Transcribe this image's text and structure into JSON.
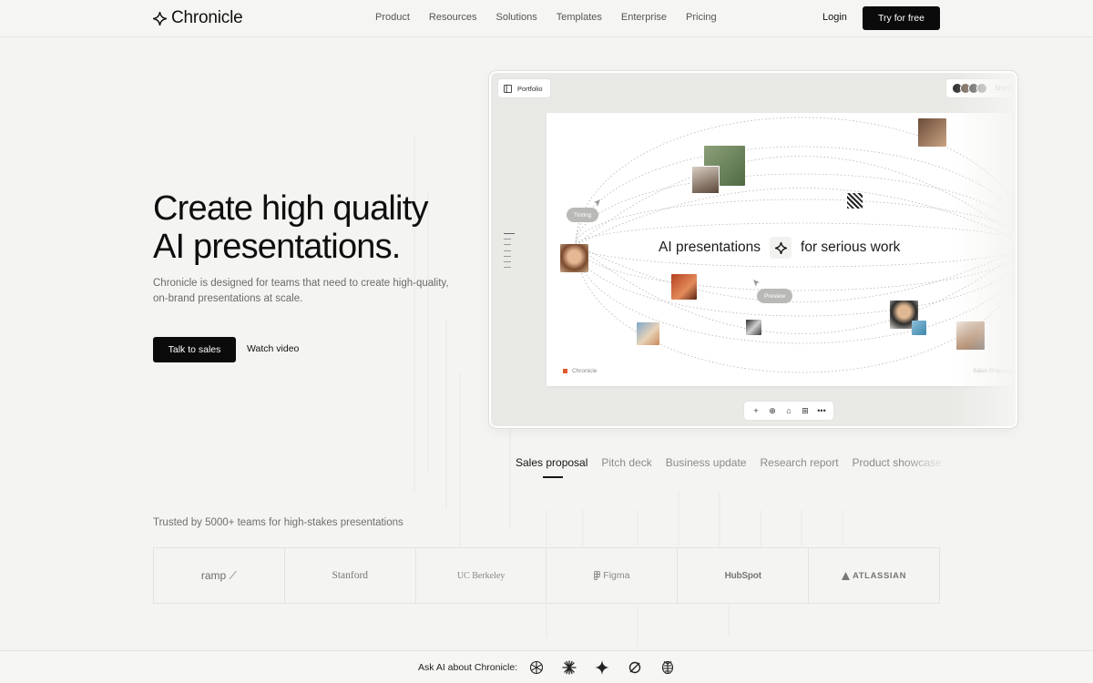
{
  "header": {
    "logo_text": "Chronicle",
    "nav": [
      "Product",
      "Resources",
      "Solutions",
      "Templates",
      "Enterprise",
      "Pricing"
    ],
    "login": "Login",
    "cta": "Try for free"
  },
  "hero": {
    "title_line1": "Create high quality",
    "title_line2": "AI presentations.",
    "description": "Chronicle is designed for teams that need to create high-quality, on-brand presentations at scale.",
    "primary_cta": "Talk to sales",
    "secondary_cta": "Watch video"
  },
  "preview": {
    "portfolio_label": "Portfolio",
    "share_label": "Share",
    "slide_headline_left": "AI presentations",
    "slide_headline_right": "for serious work",
    "tag_1": "Tinting",
    "tag_2": "Preview",
    "footer_brand": "Chronicle",
    "footer_right": "Sales Proposal",
    "toolbar": [
      "+",
      "⊕",
      "⌂",
      "⊞",
      "•••"
    ]
  },
  "templates": {
    "tabs": [
      "Sales proposal",
      "Pitch deck",
      "Business update",
      "Research report",
      "Product showcase"
    ],
    "active_index": 0
  },
  "trusted": {
    "label": "Trusted by 5000+ teams for high-stakes presentations",
    "logos": [
      "ramp ⟋",
      "Stanford",
      "UC Berkeley",
      "Figma",
      "HubSpot",
      "ATLASSIAN"
    ]
  },
  "ai_bar": {
    "label": "Ask AI about Chronicle:",
    "icons": [
      "openai-icon",
      "claude-icon",
      "gemini-icon",
      "perplexity-icon",
      "grok-icon"
    ]
  },
  "colors": {
    "background": "#f4f4f2",
    "primary_button": "#0b0b0b",
    "accent_orange": "#e0572a"
  }
}
